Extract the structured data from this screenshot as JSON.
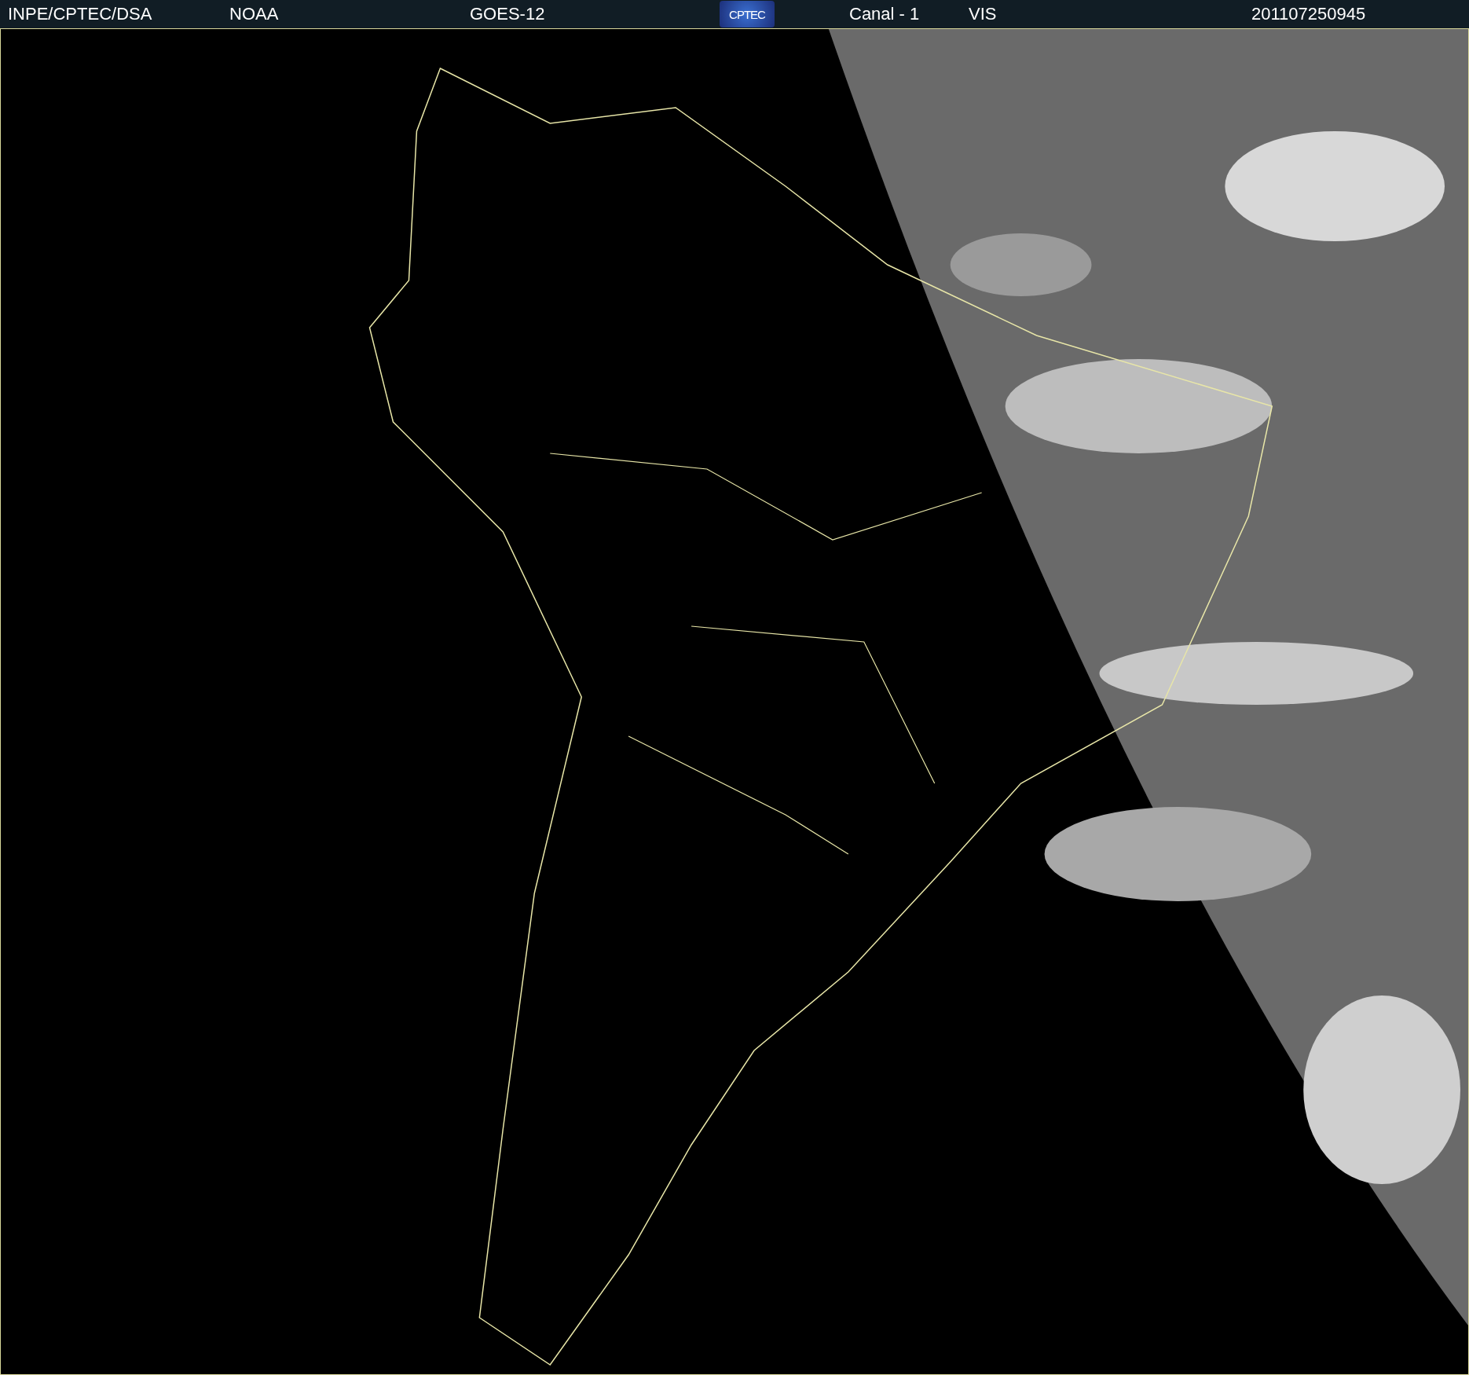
{
  "header": {
    "agency": "INPE/CPTEC/DSA",
    "operator": "NOAA",
    "satellite": "GOES-12",
    "logo": "CPTEC",
    "channel": "Canal - 1",
    "band": "VIS",
    "timestamp": "201107250945"
  }
}
